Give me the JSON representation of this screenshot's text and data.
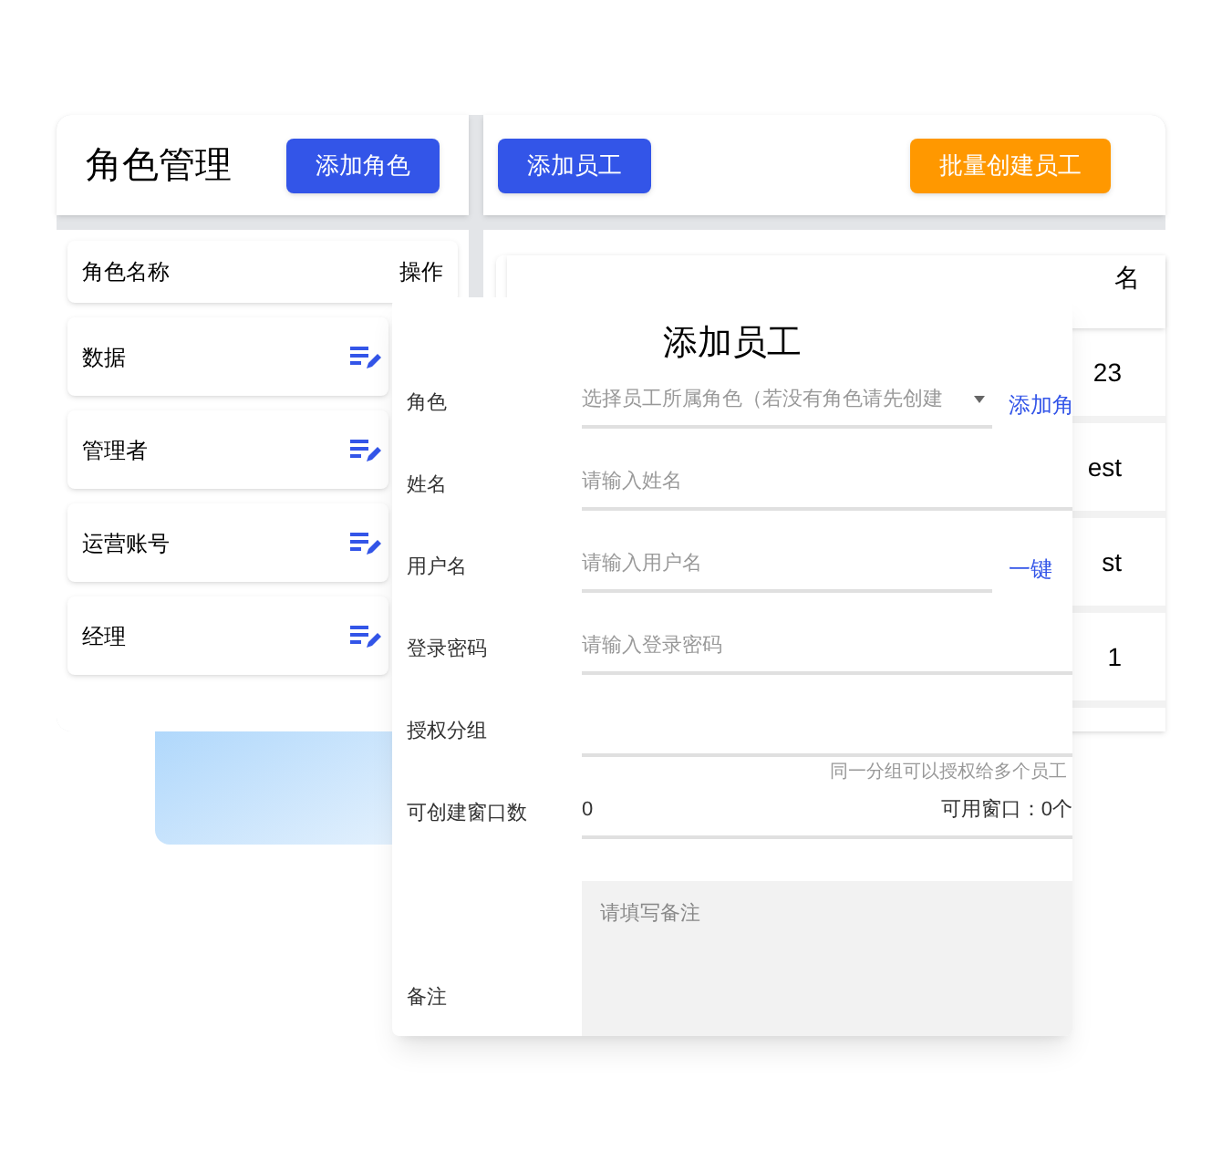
{
  "roles_panel": {
    "title": "角色管理",
    "add_button": "添加角色",
    "columns": [
      "角色名称",
      "操作"
    ],
    "rows": [
      {
        "name": "数据"
      },
      {
        "name": "管理者"
      },
      {
        "name": "运营账号"
      },
      {
        "name": "经理"
      }
    ]
  },
  "staff_panel": {
    "add_button": "添加员工",
    "batch_button": "批量创建员工",
    "header_cell": "名",
    "cells": [
      "23",
      "est",
      "st",
      "1"
    ]
  },
  "dialog": {
    "title": "添加员工",
    "fields": [
      {
        "kind": "select",
        "label": "角色",
        "placeholder": "选择员工所属角色（若没有角色请先创建",
        "link": "添加角"
      },
      {
        "kind": "input",
        "label": "姓名",
        "placeholder": "请输入姓名"
      },
      {
        "kind": "input",
        "label": "用户名",
        "placeholder": "请输入用户名",
        "link": "一键"
      },
      {
        "kind": "input",
        "label": "登录密码",
        "placeholder": "请输入登录密码"
      },
      {
        "kind": "input",
        "label": "授权分组",
        "hint": "同一分组可以授权给多个员工"
      },
      {
        "kind": "count",
        "label": "可创建窗口数",
        "value": "0",
        "side_text": "可用窗口：0个"
      },
      {
        "kind": "textarea",
        "label": "备注",
        "placeholder": "请填写备注"
      }
    ]
  }
}
